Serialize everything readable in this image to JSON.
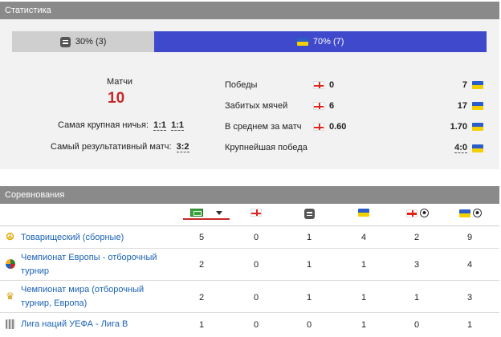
{
  "stats_panel": {
    "title": "Статистика",
    "summary_bar": {
      "left_label": "30% (3)",
      "right_label": "70% (7)",
      "left_share": 0.3,
      "right_share": 0.7
    },
    "matches_label": "Матчи",
    "matches_count": "10",
    "biggest_draw": {
      "label": "Самая крупная ничья:",
      "values": [
        "1:1",
        "1:1"
      ]
    },
    "most_goals_match": {
      "label": "Самый результативный матч:",
      "value": "3:2"
    },
    "rows": [
      {
        "label": "Победы",
        "left": "0",
        "right": "7"
      },
      {
        "label": "Забитых мячей",
        "left": "6",
        "right": "17"
      },
      {
        "label": "В среднем за матч",
        "left": "0.60",
        "right": "1.70"
      },
      {
        "label": "Крупнейшая победа",
        "left": "",
        "right": "4:0"
      }
    ]
  },
  "competitions_panel": {
    "title": "Соревнования",
    "columns": [
      {
        "name": "total",
        "icon": "total-icon"
      },
      {
        "name": "georgia-wins",
        "icon": "georgia-flag-icon"
      },
      {
        "name": "draws",
        "icon": "draw-icon"
      },
      {
        "name": "ukraine-wins",
        "icon": "ukraine-flag-icon"
      },
      {
        "name": "georgia-goals",
        "icon": "georgia-ball-icon"
      },
      {
        "name": "ukraine-goals",
        "icon": "ukraine-ball-icon"
      }
    ],
    "rows": [
      {
        "name": "Товарищеский (сборные)",
        "icon": "peace-icon",
        "values": [
          "5",
          "0",
          "1",
          "4",
          "2",
          "9"
        ]
      },
      {
        "name": "Чемпионат Европы - отборочный турнир",
        "icon": "euro-icon",
        "values": [
          "2",
          "0",
          "1",
          "1",
          "3",
          "4"
        ]
      },
      {
        "name": "Чемпионат мира (отборочный турнир, Европа)",
        "icon": "world-cup-icon",
        "values": [
          "2",
          "0",
          "1",
          "1",
          "1",
          "3"
        ]
      },
      {
        "name": "Лига наций УЕФА - Лига B",
        "icon": "nations-league-icon",
        "values": [
          "1",
          "0",
          "0",
          "1",
          "0",
          "1"
        ]
      }
    ]
  }
}
